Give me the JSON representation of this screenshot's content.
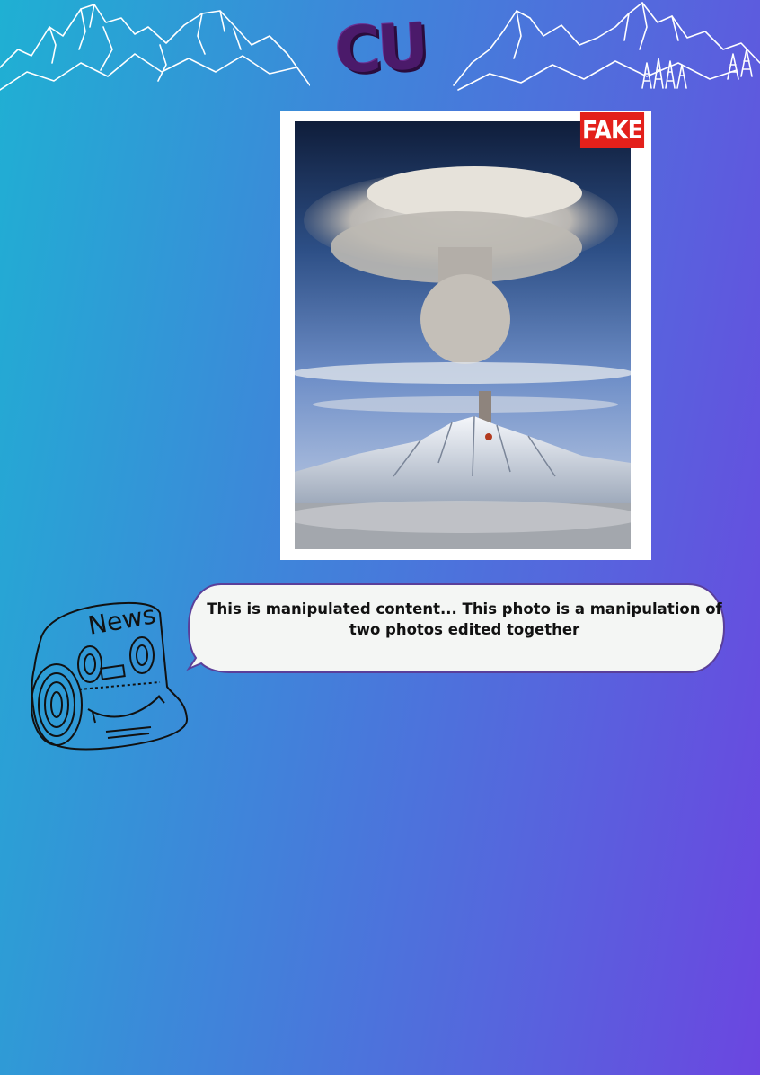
{
  "header": {
    "logo_text": "CU",
    "logo_color": "#4b1a6a",
    "decoration_left": "mountain-range-illustration",
    "decoration_right": "mountain-range-with-pine-trees-illustration"
  },
  "photo": {
    "subject": "volcano-eruption-photo",
    "badge_label": "FAKE",
    "badge_color": "#e3201b"
  },
  "mascot": {
    "icon": "newspaper-mascot-icon",
    "masthead_text": "News"
  },
  "speech_bubble": {
    "text": "This is manipulated content... This photo is a manipulation of two photos edited together"
  },
  "colors": {
    "gradient_start": "#1fb0d3",
    "gradient_end": "#6b46e0",
    "bubble_fill": "#f4f6f4",
    "bubble_border": "#5a3f9a"
  }
}
